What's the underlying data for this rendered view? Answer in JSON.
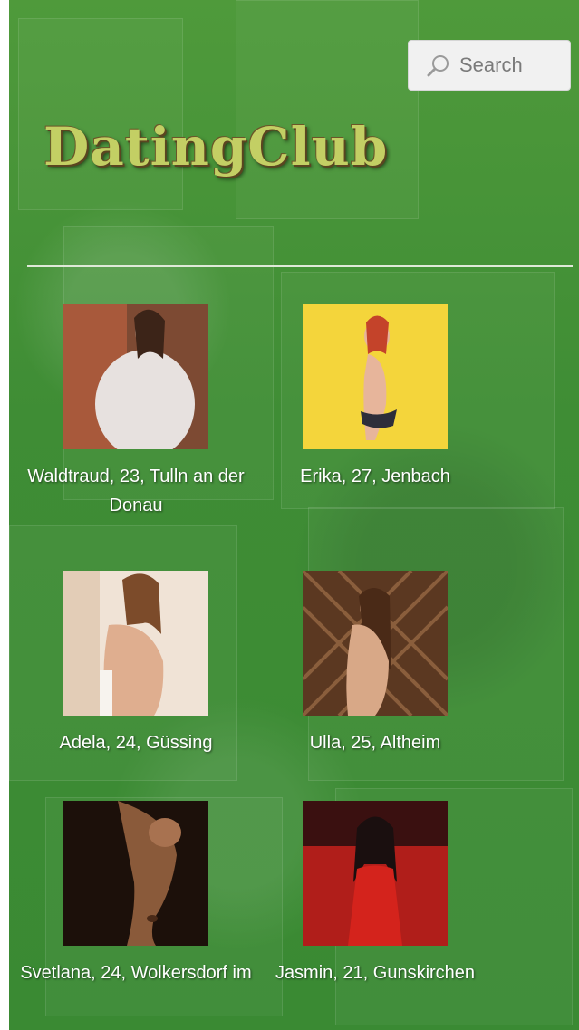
{
  "header": {
    "search_label": "Search",
    "logo_text": "DatingClub"
  },
  "profiles": [
    {
      "caption": "Waldtraud, 23, Tulln an der Donau",
      "photo_tone": "#b9a79a"
    },
    {
      "caption": "Erika, 27, Jenbach",
      "photo_tone": "#f2d43a"
    },
    {
      "caption": "Adela, 24, Güssing",
      "photo_tone": "#e3c2a5"
    },
    {
      "caption": "Ulla, 25, Altheim",
      "photo_tone": "#6a4328"
    },
    {
      "caption": "Svetlana, 24, Wolkersdorf im",
      "photo_tone": "#3a2314"
    },
    {
      "caption": "Jasmin, 21, Gunskirchen",
      "photo_tone": "#b31a18"
    }
  ],
  "colors": {
    "background_green": "#3f8d35",
    "logo_yellow": "#c3cf64",
    "caption_text": "#ffffff"
  }
}
